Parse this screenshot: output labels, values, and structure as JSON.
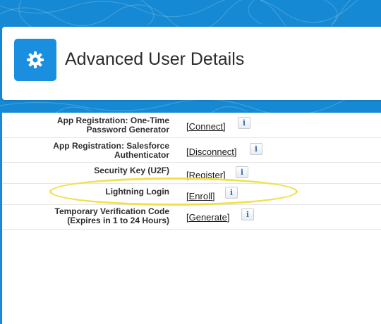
{
  "header": {
    "title": "Advanced User Details",
    "icon": "gear-icon"
  },
  "colors": {
    "banner": "#1589d3",
    "accent": "#1a8fe0",
    "highlight": "#f2e04a"
  },
  "rows": [
    {
      "label_line1": "App Registration: One-Time",
      "label_line2": "Password Generator",
      "action": "[Connect]"
    },
    {
      "label_line1": "App Registration: Salesforce",
      "label_line2": "Authenticator",
      "action": "[Disconnect]"
    },
    {
      "label_line1": "Security Key (U2F)",
      "label_line2": "",
      "action": "[Register]"
    },
    {
      "label_line1": "Lightning Login",
      "label_line2": "",
      "action": "[Enroll]"
    },
    {
      "label_line1": "Temporary Verification Code",
      "label_line2": "(Expires in 1 to 24 Hours)",
      "action": "[Generate]"
    }
  ],
  "info_icon_glyph": "i"
}
